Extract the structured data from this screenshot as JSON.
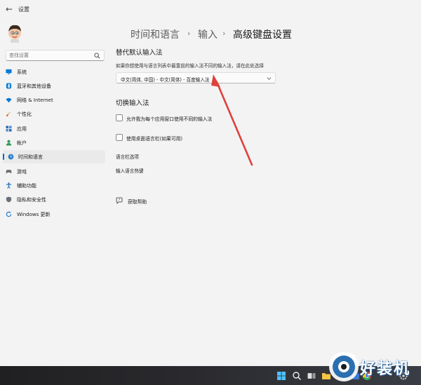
{
  "window": {
    "title": "设置",
    "back_icon": "back-arrow-icon"
  },
  "search": {
    "placeholder": "查找设置",
    "icon": "search-icon"
  },
  "sidebar": {
    "items": [
      {
        "label": "系统",
        "icon": "monitor-icon",
        "color": "#0078d4",
        "active": false
      },
      {
        "label": "蓝牙和其他设备",
        "icon": "bluetooth-icon",
        "color": "#0078d4",
        "active": false
      },
      {
        "label": "网络 & Internet",
        "icon": "wifi-icon",
        "color": "#0078d4",
        "active": false
      },
      {
        "label": "个性化",
        "icon": "brush-icon",
        "color": "#e08a2e",
        "active": false
      },
      {
        "label": "应用",
        "icon": "apps-icon",
        "color": "#2e6fb8",
        "active": false
      },
      {
        "label": "帐户",
        "icon": "person-icon",
        "color": "#2f9a52",
        "active": false
      },
      {
        "label": "时间和语言",
        "icon": "globe-clock-icon",
        "color": "#2a7fc9",
        "active": true
      },
      {
        "label": "游戏",
        "icon": "gamepad-icon",
        "color": "#6a6a6a",
        "active": false
      },
      {
        "label": "辅助功能",
        "icon": "accessibility-icon",
        "color": "#1e6fc2",
        "active": false
      },
      {
        "label": "隐私和安全性",
        "icon": "shield-icon",
        "color": "#6a7078",
        "active": false
      },
      {
        "label": "Windows 更新",
        "icon": "update-icon",
        "color": "#1e78d2",
        "active": false
      }
    ]
  },
  "breadcrumb": {
    "part1": "时间和语言",
    "part2": "输入",
    "current": "高级键盘设置",
    "separator": "›"
  },
  "override": {
    "title": "替代默认输入法",
    "description": "如果你想使用与语言列表中最靠前的输入法不同的输入法，请在此处选择",
    "dropdown_value": "中文(简体, 中国) - 中文(简体) - 百度输入法"
  },
  "switch": {
    "title": "切换输入法",
    "checkbox1_label": "允许我为每个应用窗口使用不同的输入法",
    "checkbox1_checked": false,
    "checkbox2_label": "使用桌面语言栏(如果可用)",
    "checkbox2_checked": false,
    "link1": "语言栏选项",
    "link2": "输入语言热键"
  },
  "help": {
    "label": "获取帮助",
    "icon": "help-icon"
  },
  "annotation": {
    "arrow_color": "#e0403c"
  },
  "taskbar": {
    "icons": [
      "windows-start-icon",
      "search-icon",
      "task-view-icon",
      "file-explorer-icon",
      "edge-icon",
      "store-icon",
      "chrome-icon",
      "settings-icon"
    ]
  },
  "watermark": {
    "text": "好装机"
  }
}
